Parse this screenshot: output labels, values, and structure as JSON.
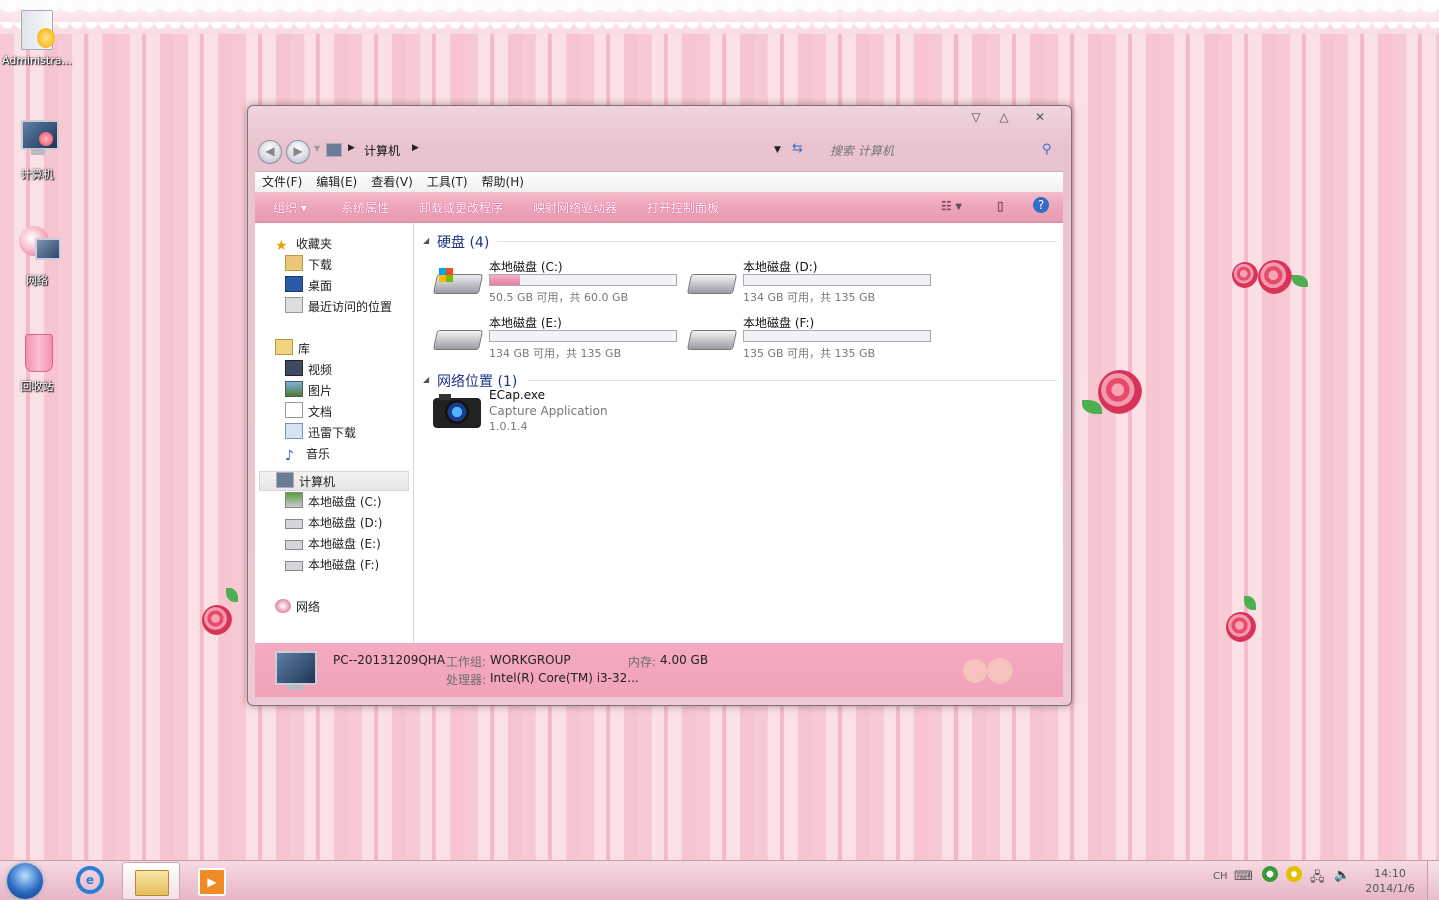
{
  "desktop": {
    "icons": [
      {
        "label": "Administra..."
      },
      {
        "label": "计算机"
      },
      {
        "label": "网络"
      },
      {
        "label": "回收站"
      }
    ]
  },
  "window": {
    "breadcrumb": "计算机",
    "search_placeholder": "搜索 计算机",
    "menu": [
      "文件(F)",
      "编辑(E)",
      "查看(V)",
      "工具(T)",
      "帮助(H)"
    ],
    "toolbar": {
      "organize": "组织",
      "system_properties": "系统属性",
      "uninstall": "卸载或更改程序",
      "map_drive": "映射网络驱动器",
      "control_panel": "打开控制面板"
    },
    "nav": {
      "favorites": "收藏夹",
      "downloads": "下载",
      "desktop": "桌面",
      "recent": "最近访问的位置",
      "libraries": "库",
      "videos": "视频",
      "pictures": "图片",
      "documents": "文档",
      "xunlei": "迅雷下载",
      "music": "音乐",
      "computer": "计算机",
      "drive_c": "本地磁盘 (C:)",
      "drive_d": "本地磁盘 (D:)",
      "drive_e": "本地磁盘 (E:)",
      "drive_f": "本地磁盘 (F:)",
      "network": "网络"
    },
    "groups": {
      "hard_disks": "硬盘 (4)",
      "network_locations": "网络位置 (1)"
    },
    "drives": [
      {
        "name": "本地磁盘 (C:)",
        "info": "50.5 GB 可用，共 60.0 GB",
        "used_fraction": 0.16
      },
      {
        "name": "本地磁盘 (D:)",
        "info": "134 GB 可用，共 135 GB",
        "used_fraction": 0.0
      },
      {
        "name": "本地磁盘 (E:)",
        "info": "134 GB 可用，共 135 GB",
        "used_fraction": 0.0
      },
      {
        "name": "本地磁盘 (F:)",
        "info": "135 GB 可用，共 135 GB",
        "used_fraction": 0.0
      }
    ],
    "network_item": {
      "name": "ECap.exe",
      "desc": "Capture Application",
      "version": "1.0.1.4"
    },
    "status": {
      "pc_name": "PC--20131209QHA",
      "workgroup_label": "工作组:",
      "workgroup": "WORKGROUP",
      "memory_label": "内存:",
      "memory": "4.00 GB",
      "cpu_label": "处理器:",
      "cpu": "Intel(R) Core(TM) i3-32..."
    }
  },
  "taskbar": {
    "lang": "CH",
    "time": "14:10",
    "date": "2014/1/6"
  },
  "colors": {
    "accent_pink": "#e89bb0",
    "link_blue": "#1e3287"
  }
}
